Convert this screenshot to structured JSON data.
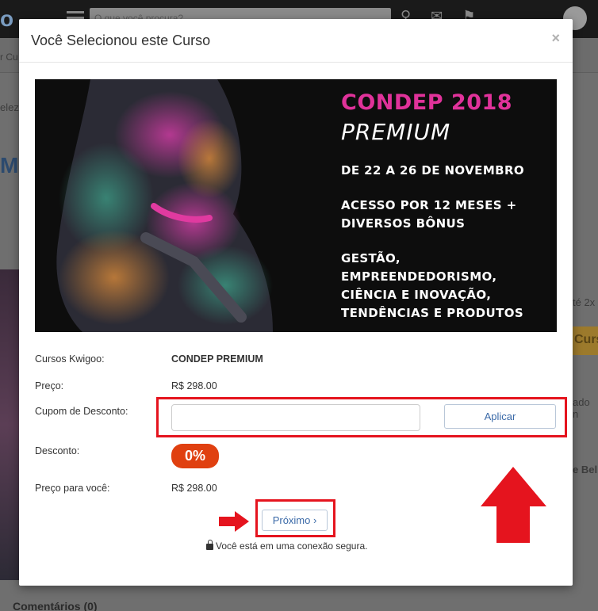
{
  "background": {
    "search_placeholder": "O que você procura?",
    "sub_text": "r Cu",
    "side_text_1": "elez",
    "big_letter": "M",
    "right_text_1": "té 2x",
    "right_button": "Curs",
    "right_text_2": "ado n",
    "right_text_3": "e Bel",
    "comments_title": "Comentários (0)"
  },
  "modal": {
    "title": "Você Selecionou este Curso",
    "close_label": "×"
  },
  "banner": {
    "title": "CONDEP 2018",
    "subtitle": "PREMIUM",
    "dates": "DE 22 A 26 DE NOVEMBRO",
    "access_line1": "ACESSO POR 12 MESES +",
    "access_line2": "DIVERSOS BÔNUS",
    "topics_line1": "GESTÃO,",
    "topics_line2": "EMPREENDEDORISMO,",
    "topics_line3": "CIÊNCIA E INOVAÇÃO,",
    "topics_line4": "TENDÊNCIAS E PRODUTOS"
  },
  "details": {
    "course_label": "Cursos Kwigoo:",
    "course_value": "CONDEP PREMIUM",
    "price_label": "Preço:",
    "price_value": "R$ 298.00",
    "coupon_label": "Cupom de Desconto:",
    "coupon_value": "",
    "apply_label": "Aplicar",
    "discount_label": "Desconto:",
    "discount_value": "0%",
    "final_price_label": "Preço para você:",
    "final_price_value": "R$ 298.00"
  },
  "footer": {
    "next_label": "Próximo ›",
    "secure_text": "Você está em uma conexão segura."
  },
  "colors": {
    "annotation_red": "#e5141e",
    "discount_orange": "#e04010",
    "banner_pink": "#e0329a",
    "link_blue": "#3b6aa8"
  }
}
